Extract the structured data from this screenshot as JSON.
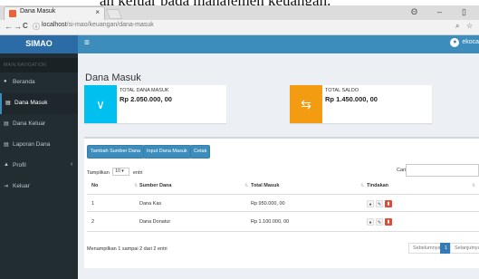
{
  "caption": "an keluar pada manajemen keuangan.",
  "browser": {
    "tab_title": "Dana Masuk",
    "tab_close": "×",
    "url_host": "localhost",
    "url_path": "/si-mao/keuangan/dana-masuk",
    "nav_back": "←",
    "nav_forward": "→",
    "nav_reload": "C",
    "window_min": "–",
    "window_restore": "▯",
    "account_glyph": "Θ"
  },
  "app": {
    "brand": "SIMAO",
    "menu_glyph": "≡",
    "user_name": "ekoca"
  },
  "sidebar": {
    "header": "MAIN NAVIGATION",
    "items": [
      {
        "label": "Beranda",
        "icon": "●"
      },
      {
        "label": "Dana Masuk",
        "icon": "▤"
      },
      {
        "label": "Dana Keluar",
        "icon": "▤"
      },
      {
        "label": "Laporan Dana",
        "icon": "▤"
      },
      {
        "label": "Profil",
        "icon": "▲"
      },
      {
        "label": "Keluar",
        "icon": "⇥"
      }
    ],
    "active_index": 1
  },
  "page": {
    "title": "Dana Masuk",
    "boxes": [
      {
        "label": "TOTAL DANA MASUK",
        "value": "Rp 2.050.000, 00",
        "icon": "∨",
        "color": "#00c0ef"
      },
      {
        "label": "TOTAL SALDO",
        "value": "Rp 1.450.000, 00",
        "icon": "⇆",
        "color": "#f39c12"
      }
    ],
    "buttons": [
      "Tambah Sumber Dana",
      "Input Dana Masuk",
      "Cetak"
    ],
    "show_prefix": "Tampilkan",
    "show_value": "10",
    "show_suffix": "entri",
    "search_label": "Cari:",
    "columns": [
      "No",
      "Sumber Dana",
      "Total Masuk",
      "Tindakan"
    ],
    "rows": [
      {
        "no": "1",
        "sumber": "Dana Kas",
        "total": "Rp 950.000, 00"
      },
      {
        "no": "2",
        "sumber": "Dana Donatur",
        "total": "Rp 1.100.000, 00"
      }
    ],
    "info": "Menampilkan 1 sampai 2 dari 2 entri",
    "pager": {
      "prev": "Sebelumnya",
      "current": "1",
      "next": "Selanjutnya"
    }
  },
  "colors": {
    "header": "#3c8dbc",
    "brand": "#2c6ca6",
    "sidebar": "#222d32",
    "danger": "#dd4b39"
  }
}
